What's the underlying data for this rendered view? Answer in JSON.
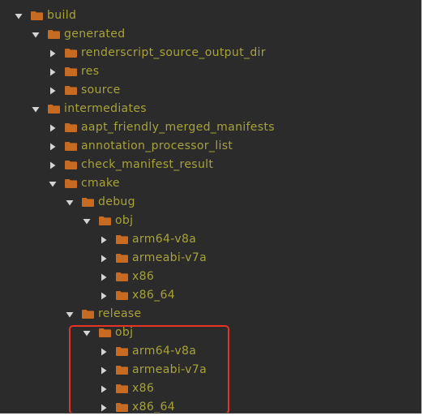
{
  "tree": {
    "items": [
      {
        "label": "build",
        "depth": 0,
        "expanded": true
      },
      {
        "label": "generated",
        "depth": 1,
        "expanded": true
      },
      {
        "label": "renderscript_source_output_dir",
        "depth": 2,
        "expanded": false
      },
      {
        "label": "res",
        "depth": 2,
        "expanded": false
      },
      {
        "label": "source",
        "depth": 2,
        "expanded": false
      },
      {
        "label": "intermediates",
        "depth": 1,
        "expanded": true
      },
      {
        "label": "aapt_friendly_merged_manifests",
        "depth": 2,
        "expanded": false
      },
      {
        "label": "annotation_processor_list",
        "depth": 2,
        "expanded": false
      },
      {
        "label": "check_manifest_result",
        "depth": 2,
        "expanded": false
      },
      {
        "label": "cmake",
        "depth": 2,
        "expanded": true
      },
      {
        "label": "debug",
        "depth": 3,
        "expanded": true
      },
      {
        "label": "obj",
        "depth": 4,
        "expanded": true
      },
      {
        "label": "arm64-v8a",
        "depth": 5,
        "expanded": false
      },
      {
        "label": "armeabi-v7a",
        "depth": 5,
        "expanded": false
      },
      {
        "label": "x86",
        "depth": 5,
        "expanded": false
      },
      {
        "label": "x86_64",
        "depth": 5,
        "expanded": false
      },
      {
        "label": "release",
        "depth": 3,
        "expanded": true
      },
      {
        "label": "obj",
        "depth": 4,
        "expanded": true
      },
      {
        "label": "arm64-v8a",
        "depth": 5,
        "expanded": false
      },
      {
        "label": "armeabi-v7a",
        "depth": 5,
        "expanded": false
      },
      {
        "label": "x86",
        "depth": 5,
        "expanded": false
      },
      {
        "label": "x86_64",
        "depth": 5,
        "expanded": false
      }
    ]
  },
  "icons": {
    "expanded": "chevron-down-icon",
    "collapsed": "chevron-right-icon",
    "folder": "folder-icon"
  },
  "colors": {
    "background": "#2b2b2b",
    "label": "#a8a23a",
    "folder": "#c76b22",
    "arrow": "#d4d4d4",
    "highlight": "#e53326"
  }
}
